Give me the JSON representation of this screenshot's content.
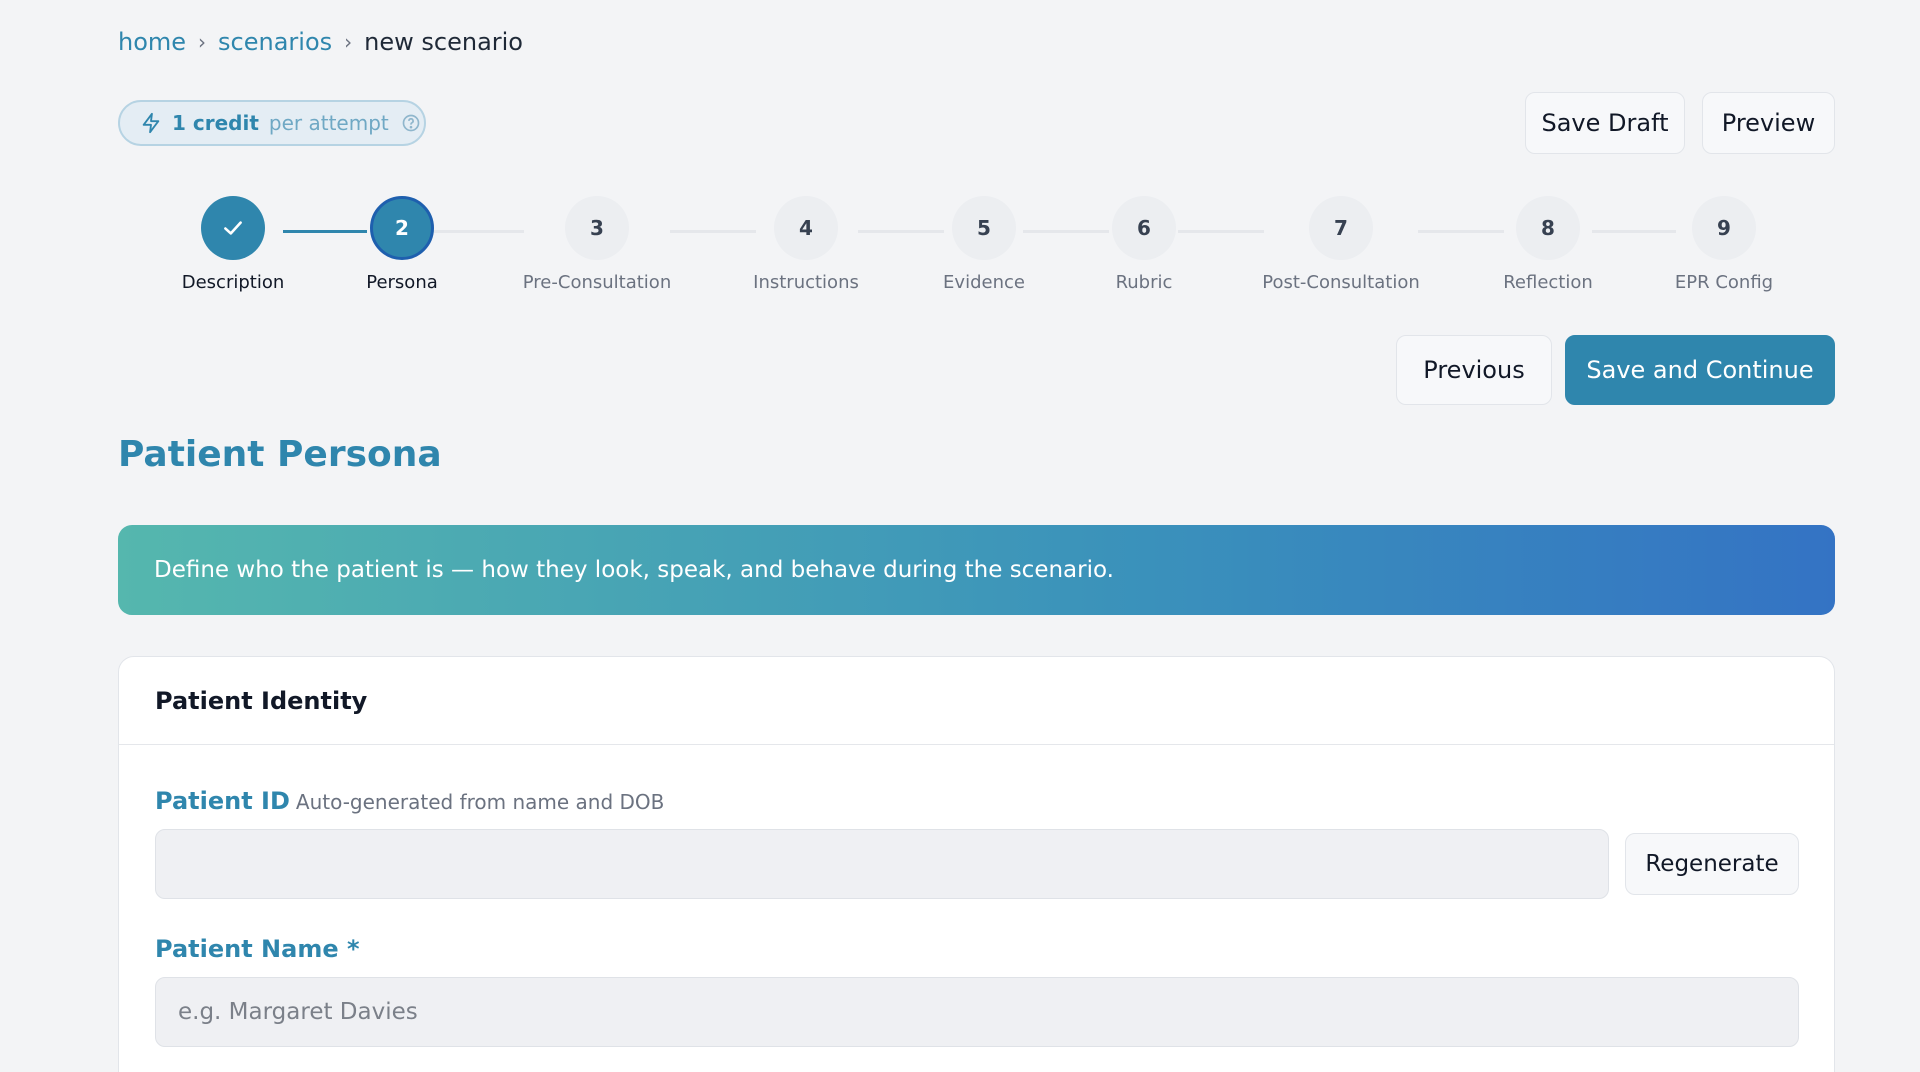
{
  "breadcrumb": {
    "items": [
      {
        "label": "home"
      },
      {
        "label": "scenarios"
      },
      {
        "label": "new scenario"
      }
    ],
    "separator": "›"
  },
  "credit": {
    "amount": "1 credit",
    "suffix": "per attempt",
    "icon": "bolt-icon",
    "help_icon": "help-circle-icon"
  },
  "toolbar": {
    "save_draft_label": "Save Draft",
    "preview_label": "Preview"
  },
  "stepper": {
    "steps": [
      {
        "number": "1",
        "label": "Description",
        "state": "done"
      },
      {
        "number": "2",
        "label": "Persona",
        "state": "active"
      },
      {
        "number": "3",
        "label": "Pre-Consultation",
        "state": "pending"
      },
      {
        "number": "4",
        "label": "Instructions",
        "state": "pending"
      },
      {
        "number": "5",
        "label": "Evidence",
        "state": "pending"
      },
      {
        "number": "6",
        "label": "Rubric",
        "state": "pending"
      },
      {
        "number": "7",
        "label": "Post-Consultation",
        "state": "pending"
      },
      {
        "number": "8",
        "label": "Reflection",
        "state": "pending"
      },
      {
        "number": "9",
        "label": "EPR Config",
        "state": "pending"
      }
    ]
  },
  "nav": {
    "previous_label": "Previous",
    "save_continue_label": "Save and Continue"
  },
  "section": {
    "title": "Patient Persona",
    "banner_text": "Define who the patient is — how they look, speak, and behave during the scenario."
  },
  "card": {
    "title": "Patient Identity",
    "patient_id": {
      "label": "Patient ID",
      "hint": "Auto-generated from name and DOB",
      "value": "",
      "regenerate_label": "Regenerate"
    },
    "patient_name": {
      "label": "Patient Name *",
      "placeholder": "e.g. Margaret Davies",
      "value": ""
    }
  },
  "colors": {
    "accent": "#2f86ad",
    "background": "#f3f4f6",
    "banner_start": "#55b7ae",
    "banner_end": "#3473c4"
  }
}
